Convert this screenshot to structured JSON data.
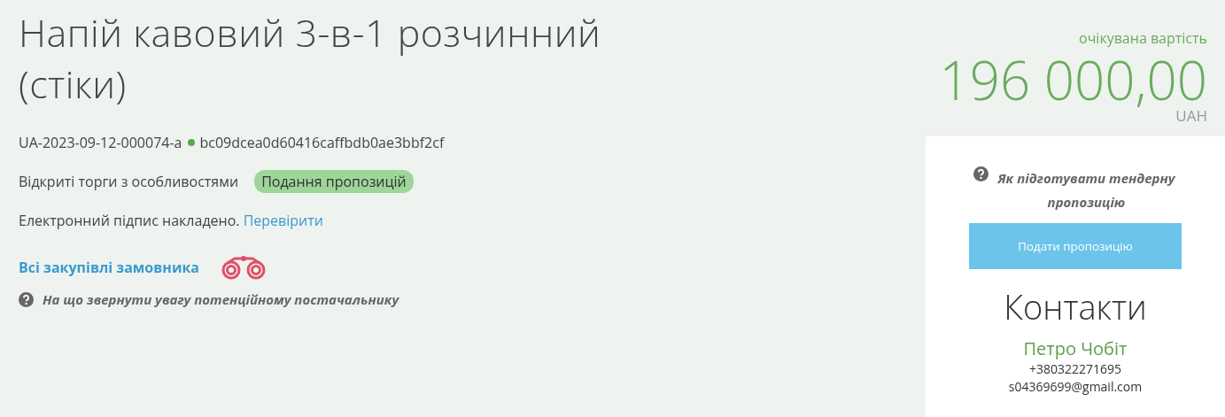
{
  "title": "Напій кавовий 3-в-1 розчинний (стіки)",
  "tender_id": "UA-2023-09-12-000074-a",
  "hash": "bc09dcea0d60416caffbdb0ae3bbf2cf",
  "procedure": "Відкриті торги з особливостями",
  "status": "Подання пропозицій",
  "signature": {
    "text": "Електронний підпис накладено.",
    "link": "Перевірити"
  },
  "customer_link": "Всі закупівлі замовника",
  "hint": "На що звернути увагу потенційному постачальнику",
  "expected": {
    "label": "очікувана вартість",
    "amount": "196 000,00",
    "currency": "UAH"
  },
  "sidebar": {
    "hint": "Як підготувати тендерну пропозицію",
    "button": "Подати пропозицію",
    "contacts_title": "Контакти",
    "name": "Петро Чобіт",
    "phone": "+380322271695",
    "email": "s04369699@gmail.com"
  }
}
